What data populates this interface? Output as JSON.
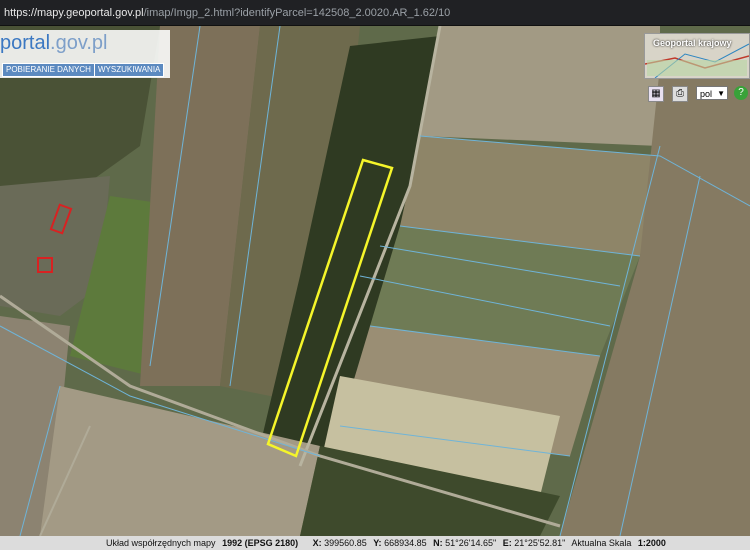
{
  "browser": {
    "url_host": "https://mapy.geoportal.gov.pl",
    "url_path": "/imap/Imgp_2.html?identifyParcel=142508_2.0020.AR_1.62/10"
  },
  "header": {
    "logo_main": "portal",
    "logo_domain": ".gov.pl",
    "download_label": "POBIERANIE DANYCH",
    "search_label": "WYSZUKIWANIA"
  },
  "overview_map": {
    "title": "Geoportal krajowy"
  },
  "toolbar": {
    "language_value": "pol"
  },
  "colors": {
    "parcel_outline": "#f5f52a",
    "boundary_lines": "#6fb4d8"
  },
  "status": {
    "crs_label": "Układ współrzędnych mapy",
    "crs_value": "1992 (EPSG 2180)",
    "x_label": "X:",
    "x_value": "399560.85",
    "y_label": "Y:",
    "y_value": "668934.85",
    "n_label": "N:",
    "n_value": "51°26'14.65\"",
    "e_label": "E:",
    "e_value": "21°25'52.81\"",
    "scale_label": "Aktualna Skala",
    "scale_value": "1:2000"
  }
}
